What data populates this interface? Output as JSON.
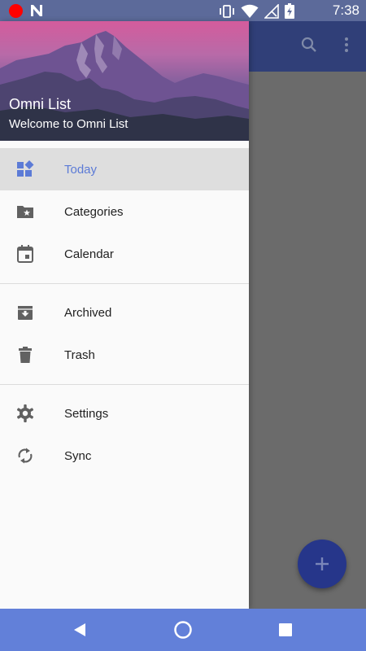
{
  "status_bar": {
    "time": "7:38",
    "left_icons": [
      "record-icon",
      "n-notification-icon"
    ],
    "right_icons": [
      "vibrate-icon",
      "wifi-icon",
      "no-signal-icon",
      "battery-charging-icon"
    ]
  },
  "app_bar": {
    "color": "#303f78",
    "icons": [
      "search-icon",
      "more-vert-icon"
    ]
  },
  "drawer": {
    "header": {
      "title": "Omni List",
      "subtitle": "Welcome to Omni List"
    },
    "groups": [
      [
        {
          "label": "Today",
          "icon": "dashboard-icon",
          "active": true
        },
        {
          "label": "Categories",
          "icon": "folder-star-icon",
          "active": false
        },
        {
          "label": "Calendar",
          "icon": "calendar-icon",
          "active": false
        }
      ],
      [
        {
          "label": "Archived",
          "icon": "archive-icon",
          "active": false
        },
        {
          "label": "Trash",
          "icon": "trash-icon",
          "active": false
        }
      ],
      [
        {
          "label": "Settings",
          "icon": "settings-icon",
          "active": false
        },
        {
          "label": "Sync",
          "icon": "sync-icon",
          "active": false
        }
      ]
    ],
    "accent_color": "#5c7bd6"
  },
  "fab": {
    "icon": "add-icon",
    "color": "#26368a"
  },
  "nav_bar": {
    "color": "#6280d9",
    "buttons": [
      "back-icon",
      "home-icon",
      "recents-icon"
    ]
  }
}
